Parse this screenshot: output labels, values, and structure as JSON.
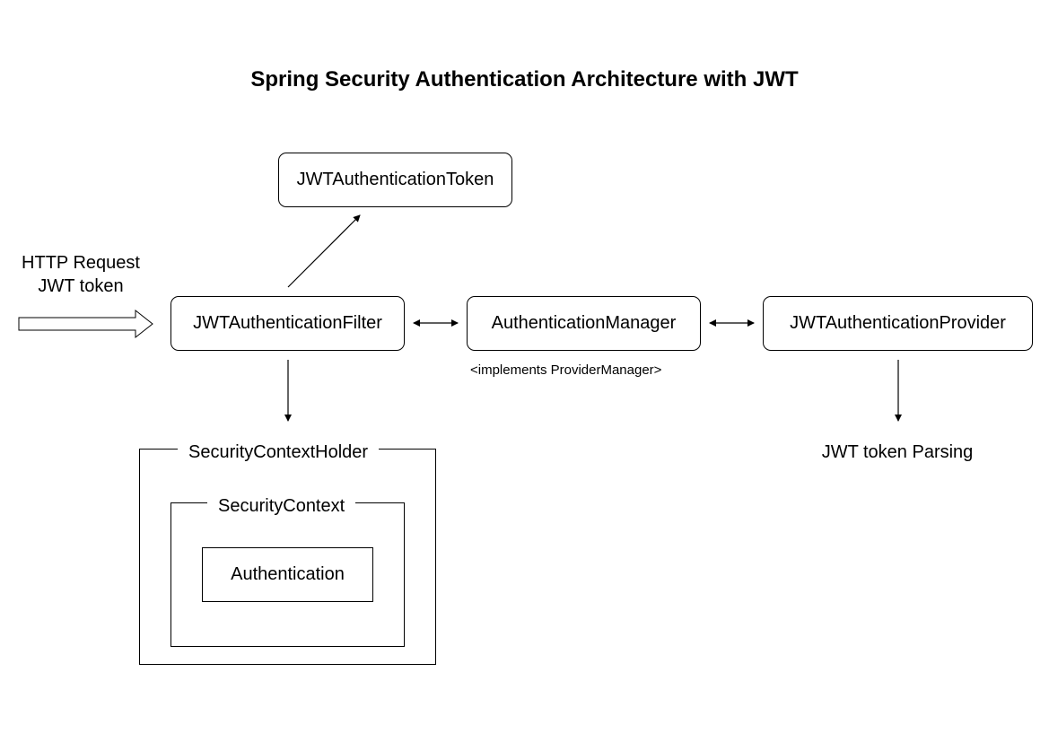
{
  "title": "Spring Security Authentication Architecture with JWT",
  "nodes": {
    "token": "JWTAuthenticationToken",
    "filter": "JWTAuthenticationFilter",
    "manager": "AuthenticationManager",
    "provider": "JWTAuthenticationProvider"
  },
  "input": {
    "line1": "HTTP Request",
    "line2": "JWT token"
  },
  "manager_note": "<implements ProviderManager>",
  "provider_output": "JWT token Parsing",
  "context": {
    "holder": "SecurityContextHolder",
    "context": "SecurityContext",
    "authentication": "Authentication"
  }
}
